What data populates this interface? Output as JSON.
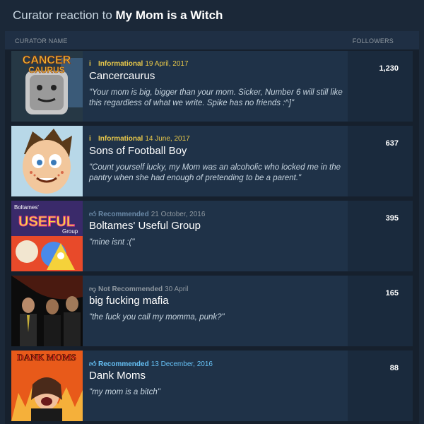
{
  "header": {
    "prefix": "Curator reaction to ",
    "game_title": "My Mom is a Witch"
  },
  "columns": {
    "name": "CURATOR NAME",
    "followers": "FOLLOWERS"
  },
  "curators": [
    {
      "name": "Cancercaurus",
      "type": "Informational",
      "date": "19 April, 2017",
      "icon": "info-icon",
      "quote": "\"Your mom is big, bigger than your mom. Sicker, Number 6 will still like this regardless of what we write. Spike has no friends :^]\"",
      "followers": "1,230",
      "thumb_text": "CANCER CAURUS"
    },
    {
      "name": "Sons of Football Boy",
      "type": "Informational",
      "date": "14 June, 2017",
      "icon": "info-icon",
      "quote": "\"Count yourself lucky, my Mom was an alcoholic who locked me in the pantry when she had enough of pretending to be a parent.\"",
      "followers": "637"
    },
    {
      "name": "Boltames' Useful Group",
      "type": "Recommended",
      "date": "21 October, 2016",
      "icon": "thumbs-up-icon",
      "quote": "\"mine isnt :(\"",
      "followers": "395",
      "thumb_text": "USEFUL",
      "thumb_text_top": "Boltames'",
      "thumb_text_side": "Group"
    },
    {
      "name": "big fucking mafia",
      "type": "Not Recommended",
      "date": "30 April",
      "icon": "thumbs-down-icon",
      "quote": "\"the fuck you call my momma, punk?\"",
      "followers": "165"
    },
    {
      "name": "Dank Moms",
      "type": "Recommended",
      "date": "13 December, 2016",
      "icon": "thumbs-up-icon",
      "quote": "\"my mom is a bitch\"",
      "followers": "88",
      "thumb_text": "DANK MOMS"
    }
  ]
}
